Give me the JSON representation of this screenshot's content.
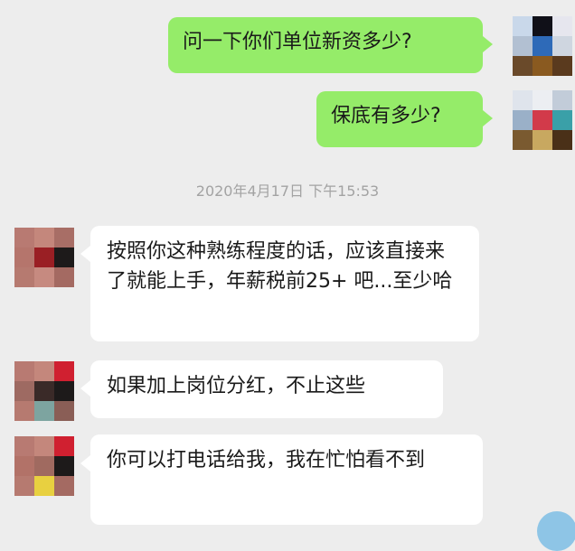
{
  "chat": {
    "timestamp": "2020年4月17日 下午15:53",
    "messages": [
      {
        "side": "right",
        "text": "问一下你们单位新资多少?"
      },
      {
        "side": "right",
        "text": "保底有多少?"
      },
      {
        "side": "left",
        "text": "按照你这种熟练程度的话，应该直接来了就能上手，年薪税前25+ 吧...至少哈"
      },
      {
        "side": "left",
        "text": "如果加上岗位分红，不止这些"
      },
      {
        "side": "left",
        "text": "你可以打电话给我，我在忙怕看不到"
      }
    ]
  },
  "colors": {
    "background": "#ededed",
    "sent_bubble": "#95ec69",
    "received_bubble": "#ffffff",
    "timestamp_text": "#a3a3a3"
  }
}
